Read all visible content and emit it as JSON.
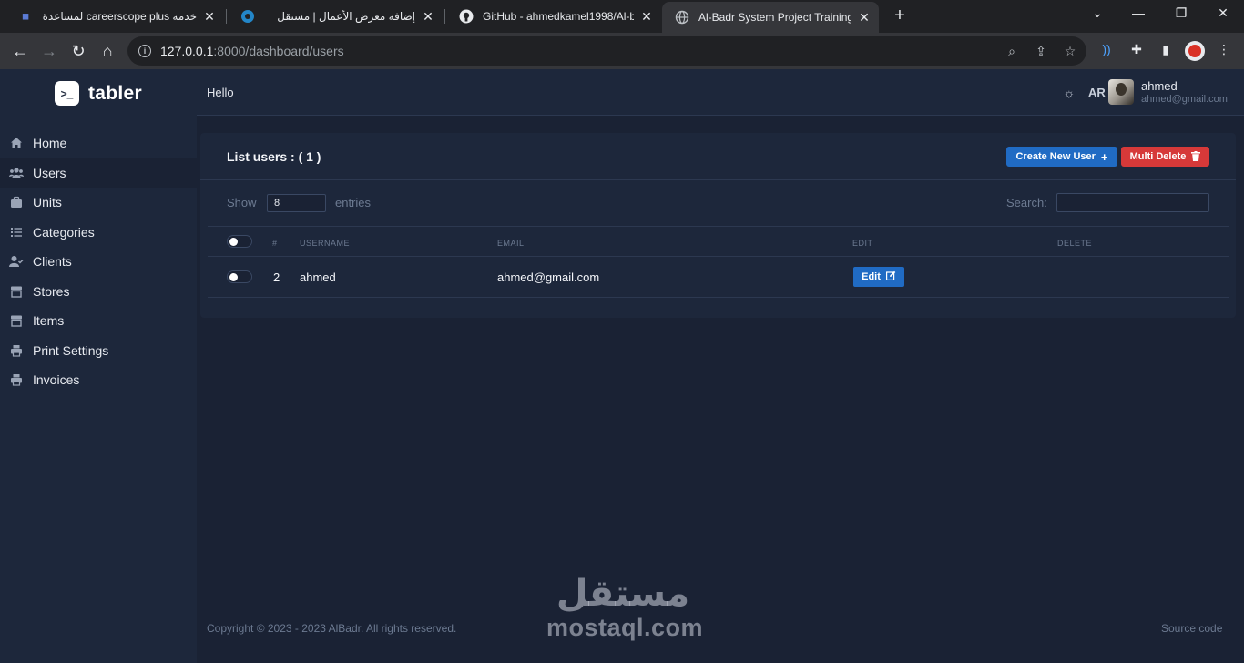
{
  "browser": {
    "tabs": [
      {
        "title": "خدمة careerscope plus لمساعدة",
        "favicon": "document-icon",
        "active": false
      },
      {
        "title": "إضافة معرض الأعمال | مستقل",
        "favicon": "mostaql-icon",
        "active": false
      },
      {
        "title": "GitHub - ahmedkamel1998/Al-b",
        "favicon": "github-icon",
        "active": false
      },
      {
        "title": "Al-Badr System Project Training.",
        "favicon": "globe-icon",
        "active": true
      }
    ],
    "url_host": "127.0.0.1",
    "url_path": ":8000/dashboard/users"
  },
  "brand": {
    "name": "tabler",
    "logo_glyph": ">_"
  },
  "sidebar": {
    "items": [
      {
        "label": "Home",
        "icon": "home-icon"
      },
      {
        "label": "Users",
        "icon": "users-icon"
      },
      {
        "label": "Units",
        "icon": "briefcase-icon"
      },
      {
        "label": "Categories",
        "icon": "list-icon"
      },
      {
        "label": "Clients",
        "icon": "user-check-icon"
      },
      {
        "label": "Stores",
        "icon": "store-icon"
      },
      {
        "label": "Items",
        "icon": "store-icon"
      },
      {
        "label": "Print Settings",
        "icon": "print-icon"
      },
      {
        "label": "Invoices",
        "icon": "print-icon"
      }
    ],
    "active_index": 1
  },
  "header": {
    "greeting": "Hello",
    "language": "AR",
    "user_name": "ahmed",
    "user_email": "ahmed@gmail.com"
  },
  "card": {
    "title": "List users : ( 1 )",
    "create_label": "Create New User",
    "multi_delete_label": "Multi Delete",
    "show_label": "Show",
    "show_value": "8",
    "entries_label": "entries",
    "search_label": "Search:",
    "search_value": ""
  },
  "table": {
    "columns": [
      "#",
      "USERNAME",
      "EMAIL",
      "EDIT",
      "DELETE"
    ],
    "rows": [
      {
        "id": "2",
        "username": "ahmed",
        "email": "ahmed@gmail.com",
        "edit_label": "Edit"
      }
    ]
  },
  "footer": {
    "copyright": "Copyright © 2023 - 2023 AlBadr. All rights reserved.",
    "source": "Source code"
  },
  "watermark": {
    "arabic": "مستقل",
    "latin": "mostaql.com"
  },
  "colors": {
    "primary": "#206bc4",
    "danger": "#d63939",
    "background": "#1a2234",
    "surface": "#1d273b"
  }
}
